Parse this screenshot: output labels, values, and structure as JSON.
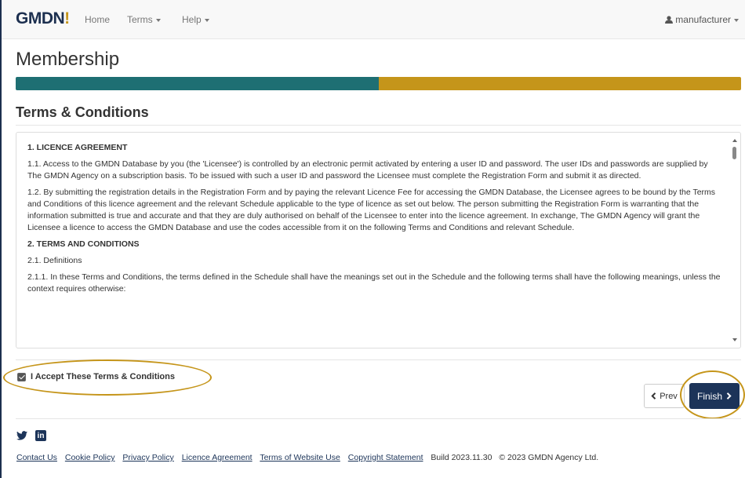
{
  "nav": {
    "brand_main": "GMDN",
    "brand_accent": "!",
    "home": "Home",
    "terms": "Terms",
    "help": "Help",
    "user": "manufacturer"
  },
  "header": {
    "title": "Membership",
    "progress_fraction": 0.5,
    "section_title": "Terms & Conditions"
  },
  "terms": {
    "h1": "1. LICENCE AGREEMENT",
    "p1_1": "1.1. Access to the GMDN Database by you (the 'Licensee') is controlled by an electronic permit activated by entering a user ID and password. The user IDs and passwords are supplied by The GMDN Agency on a subscription basis. To be issued with such a user ID and password the Licensee must complete the Registration Form and submit it as directed.",
    "p1_2": "1.2. By submitting the registration details in the Registration Form and by paying the relevant Licence Fee for accessing the GMDN Database, the Licensee agrees to be bound by the Terms and Conditions of this licence agreement and the relevant Schedule applicable to the type of licence as set out below. The person submitting the Registration Form is warranting that the information submitted is true and accurate and that they are duly authorised on behalf of the Licensee to enter into the licence agreement. In exchange, The GMDN Agency will grant the Licensee a licence to access the GMDN Database and use the codes accessible from it on the following Terms and Conditions and relevant Schedule.",
    "h2": "2. TERMS AND CONDITIONS",
    "p2_1": "2.1. Definitions",
    "p2_1_1": "2.1.1. In these Terms and Conditions, the terms defined in the Schedule shall have the meanings set out in the Schedule and the following terms shall have the following meanings, unless the context requires otherwise:"
  },
  "accept": {
    "label": "I Accept These Terms & Conditions",
    "checked": true
  },
  "buttons": {
    "prev": "Prev",
    "finish": "Finish"
  },
  "footer": {
    "links": [
      "Contact Us",
      "Cookie Policy",
      "Privacy Policy",
      "Licence Agreement",
      "Terms of Website Use",
      "Copyright Statement"
    ],
    "build": "Build 2023.11.30",
    "copyright": "© 2023 GMDN Agency Ltd."
  },
  "colors": {
    "brand_navy": "#1c3459",
    "progress_done": "#1e6f73",
    "progress_remaining": "#c5951a",
    "highlight": "#c5951a"
  },
  "icons": [
    "user-icon",
    "twitter-icon",
    "linkedin-icon",
    "chevron-left-icon",
    "chevron-right-icon",
    "scroll-up-icon",
    "scroll-down-icon"
  ]
}
